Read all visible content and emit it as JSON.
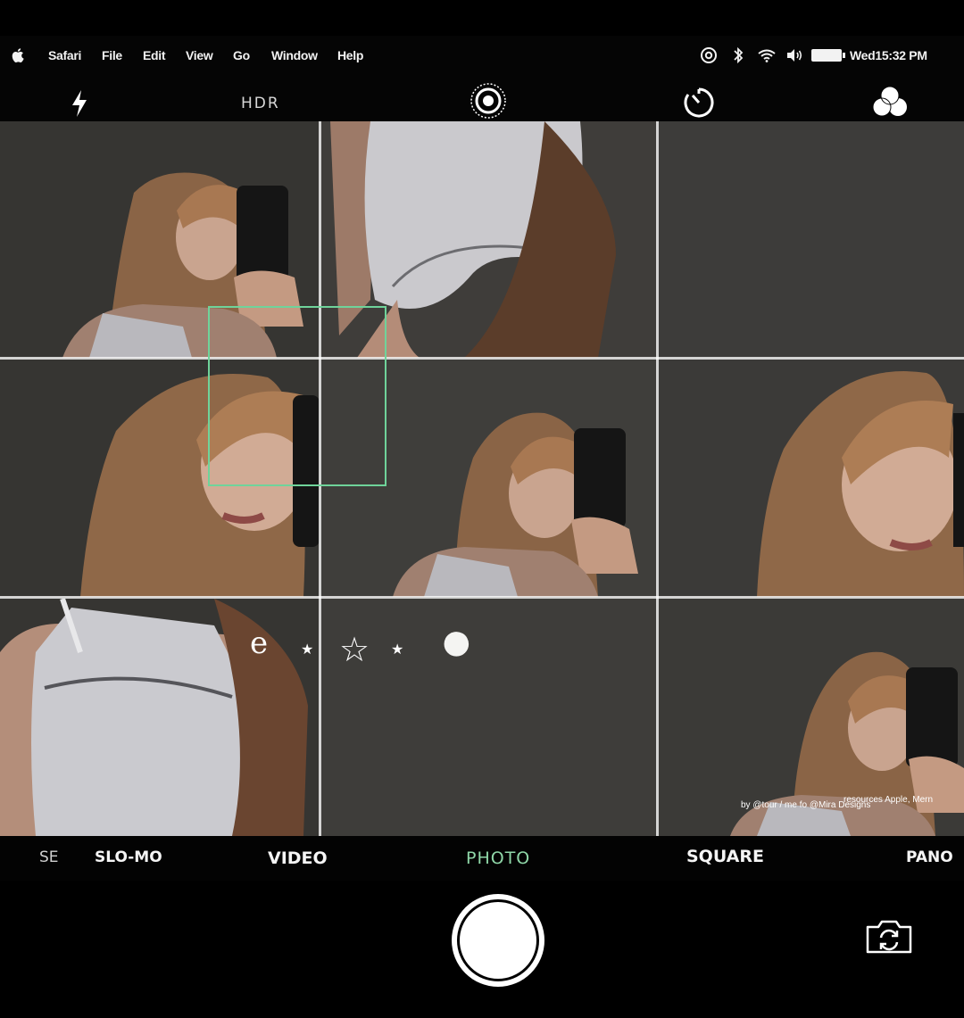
{
  "menubar": {
    "apple_icon": "apple-logo",
    "items": [
      "Safari",
      "File",
      "Edit",
      "View",
      "Go",
      "Window",
      "Help"
    ],
    "clock": "Wed15:32  PM",
    "status_icons": [
      "at-icon",
      "bluetooth-icon",
      "wifi-icon",
      "volume-icon",
      "battery-icon"
    ]
  },
  "camera_toolbar": {
    "flash_icon": "lightning-icon",
    "hdr_label": "HDR",
    "live_icon": "live-photo-icon",
    "timer_icon": "timer-icon",
    "filters_icon": "filters-icon"
  },
  "viewfinder": {
    "grid": "3x3",
    "focus_box_color": "#6fd39a",
    "overlay_doodles": [
      "e",
      "★",
      "☆",
      "★",
      "●"
    ],
    "credit_lines": [
      "resources Apple, Mern",
      "by @tour / me fo @Mira Designs"
    ]
  },
  "modes": {
    "items": [
      "SE",
      "SLO-MO",
      "VIDEO",
      "PHOTO",
      "SQUARE",
      "PANO"
    ],
    "active": "PHOTO"
  },
  "controls": {
    "shutter_icon": "shutter-button",
    "flip_icon": "camera-flip-icon"
  },
  "colors": {
    "accent": "#8fd7a8",
    "background": "#000000",
    "viewfinder": "#3c3b39"
  }
}
